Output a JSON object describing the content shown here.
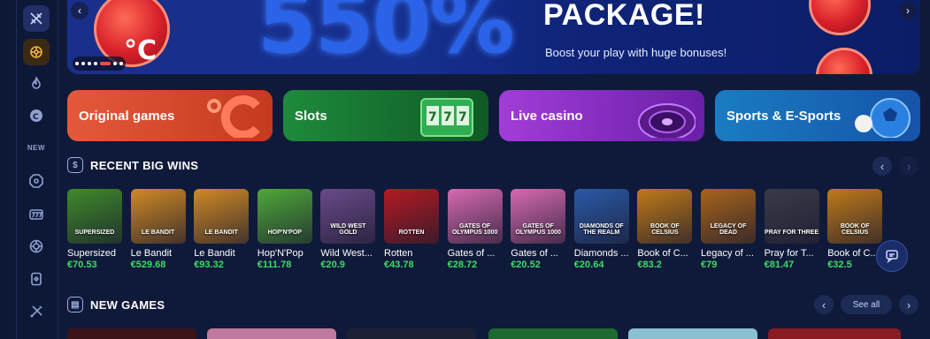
{
  "sidebar": {
    "new_label": "NEW",
    "icons": [
      "crossed-swords-icon",
      "wheel-icon",
      "flame-icon",
      "degree-c-icon",
      "octagon-icon",
      "slot-777-icon",
      "roulette-icon",
      "card-icon",
      "swords-icon"
    ]
  },
  "hero": {
    "big_text": "550%",
    "title": "PACKAGE!",
    "subtitle": "Boost your play with huge bonuses!",
    "prev": "‹",
    "next": "›"
  },
  "categories": [
    {
      "label": "Original games"
    },
    {
      "label": "Slots"
    },
    {
      "label": "Live casino"
    },
    {
      "label": "Sports & E-Sports"
    }
  ],
  "recent_wins": {
    "title": "RECENT BIG WINS",
    "items": [
      {
        "name": "Supersized",
        "amount": "€70.53",
        "thumb_text": "SUPERSIZED",
        "color": "#3f8a2a"
      },
      {
        "name": "Le Bandit",
        "amount": "€529.68",
        "thumb_text": "LE BANDIT",
        "color": "#d08a24"
      },
      {
        "name": "Le Bandit",
        "amount": "€93.32",
        "thumb_text": "LE BANDIT",
        "color": "#d08a24"
      },
      {
        "name": "Hop'N'Pop",
        "amount": "€111.78",
        "thumb_text": "HOP'N'POP",
        "color": "#4fa83a"
      },
      {
        "name": "Wild West...",
        "amount": "€20.9",
        "thumb_text": "WILD WEST GOLD",
        "color": "#6a4a8a"
      },
      {
        "name": "Rotten",
        "amount": "€43.78",
        "thumb_text": "ROTTEN",
        "color": "#b41a22"
      },
      {
        "name": "Gates of ...",
        "amount": "€28.72",
        "thumb_text": "GATES OF OLYMPUS 1000",
        "color": "#d66ab0"
      },
      {
        "name": "Gates of ...",
        "amount": "€20.52",
        "thumb_text": "GATES OF OLYMPUS 1000",
        "color": "#d66ab0"
      },
      {
        "name": "Diamonds ...",
        "amount": "€20.64",
        "thumb_text": "DIAMONDS OF THE REALM",
        "color": "#2a5aa8"
      },
      {
        "name": "Book of C...",
        "amount": "€83.2",
        "thumb_text": "BOOK OF CELSIUS",
        "color": "#c07a18"
      },
      {
        "name": "Legacy of ...",
        "amount": "€79",
        "thumb_text": "LEGACY OF DEAD",
        "color": "#a8641a"
      },
      {
        "name": "Pray for T...",
        "amount": "€81.47",
        "thumb_text": "PRAY FOR THREE",
        "color": "#3a3a4a"
      },
      {
        "name": "Book of C...",
        "amount": "€32.5",
        "thumb_text": "BOOK OF CELSIUS",
        "color": "#c07a18"
      }
    ]
  },
  "new_games": {
    "title": "NEW GAMES",
    "see_all": "See all",
    "prev": "‹",
    "next": "›"
  },
  "colors": {
    "background": "#0f1a3a",
    "win_amount": "#3ddc64",
    "accent_red": "#d8202a"
  }
}
